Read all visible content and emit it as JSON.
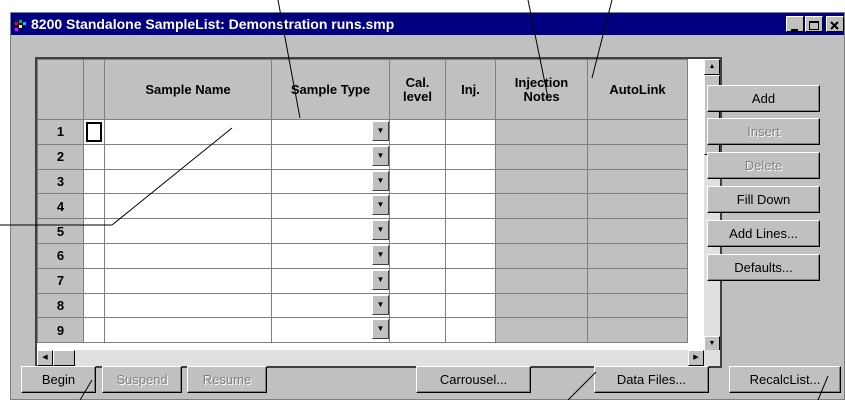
{
  "window": {
    "title": "8200 Standalone SampleList: Demonstration runs.smp"
  },
  "grid": {
    "columns": [
      {
        "label": "Sample Name"
      },
      {
        "label": "Sample Type"
      },
      {
        "label": "Cal. level"
      },
      {
        "label": "Inj."
      },
      {
        "label": "Injection Notes"
      },
      {
        "label": "AutoLink"
      }
    ],
    "rows": [
      "1",
      "2",
      "3",
      "4",
      "5",
      "6",
      "7",
      "8",
      "9"
    ]
  },
  "side_buttons": {
    "add": "Add",
    "insert": "Insert",
    "delete": "Delete",
    "fill_down": "Fill Down",
    "add_lines": "Add Lines...",
    "defaults": "Defaults..."
  },
  "bottom_buttons": {
    "begin": "Begin",
    "suspend": "Suspend",
    "resume": "Resume",
    "carrousel": "Carrousel...",
    "data_files": "Data Files...",
    "recalc_list": "RecalcList..."
  },
  "colors": {
    "titlebar": "#000080",
    "face": "#c0c0c0"
  }
}
